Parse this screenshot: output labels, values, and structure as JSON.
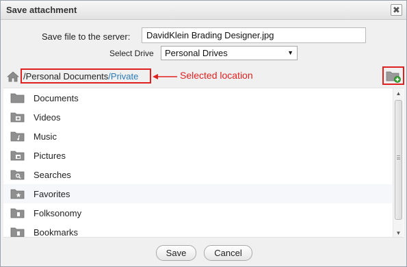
{
  "dialog": {
    "title": "Save attachment",
    "close_glyph": "✖"
  },
  "form": {
    "save_label": "Save file to the server:",
    "filename_value": "DavidKlein Brading Designer.jpg",
    "drive_label": "Select Drive",
    "drive_value": "Personal Drives"
  },
  "path": {
    "main": "/Personal Documents",
    "current": "/Private",
    "annotation": "Selected location",
    "annotation_color": "#e02020"
  },
  "folders": [
    {
      "label": "Documents",
      "icon": "folder-icon"
    },
    {
      "label": "Videos",
      "icon": "video-folder-icon"
    },
    {
      "label": "Music",
      "icon": "music-folder-icon"
    },
    {
      "label": "Pictures",
      "icon": "pictures-folder-icon"
    },
    {
      "label": "Searches",
      "icon": "search-folder-icon"
    },
    {
      "label": "Favorites",
      "icon": "favorites-folder-icon"
    },
    {
      "label": "Folksonomy",
      "icon": "tag-folder-icon"
    },
    {
      "label": "Bookmarks",
      "icon": "bookmark-folder-icon"
    }
  ],
  "footer": {
    "save_label": "Save",
    "cancel_label": "Cancel"
  }
}
